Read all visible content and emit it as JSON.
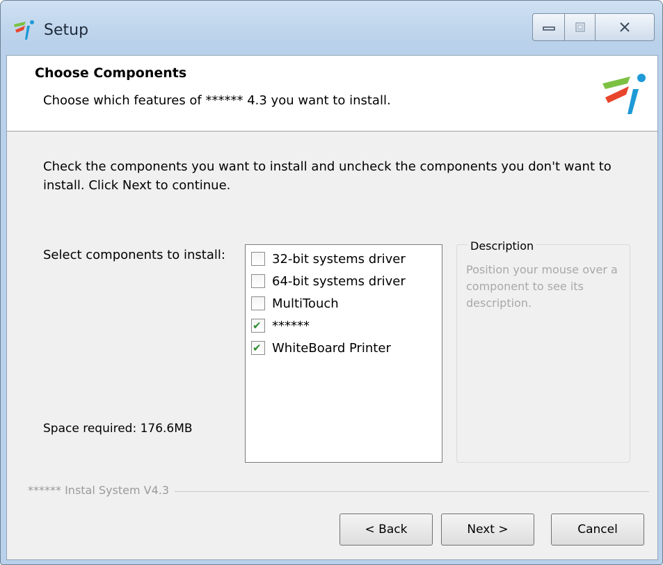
{
  "window": {
    "title": "Setup",
    "controls": {
      "minimize_icon": "minimize-icon",
      "maximize_icon": "maximize-icon",
      "close_icon": "close-icon"
    }
  },
  "header": {
    "title": "Choose Components",
    "subtitle": "Choose which features of ****** 4.3 you want to install."
  },
  "body": {
    "instructions": "Check the components you want to install and uncheck the components you don't want to install. Click Next to continue.",
    "select_label": "Select components to install:",
    "space_required": "Space required: 176.6MB"
  },
  "components": [
    {
      "label": "32-bit systems driver",
      "checked": false
    },
    {
      "label": "64-bit systems driver",
      "checked": false
    },
    {
      "label": "MultiTouch",
      "checked": false
    },
    {
      "label": "******",
      "checked": true
    },
    {
      "label": "WhiteBoard Printer",
      "checked": true
    }
  ],
  "description": {
    "title": "Description",
    "text": "Position your mouse over a component to see its description."
  },
  "footer": {
    "brand": "****** Instal System V4.3",
    "back_label": "< Back",
    "next_label": "Next >",
    "cancel_label": "Cancel"
  },
  "colors": {
    "tick": "#2b8a2b",
    "logo_green": "#7cc142",
    "logo_red": "#e8452c",
    "logo_blue": "#1e9ad6"
  }
}
